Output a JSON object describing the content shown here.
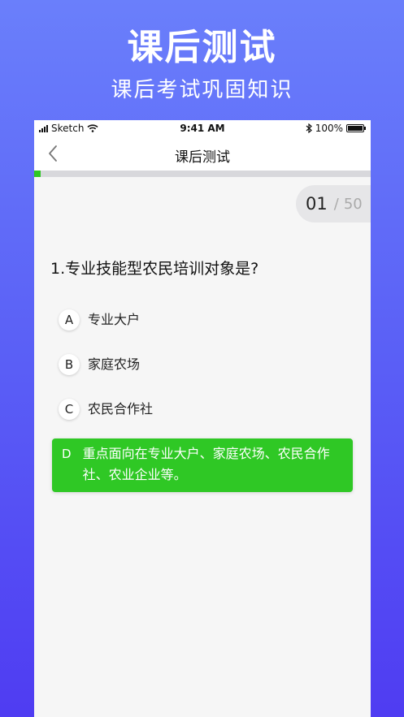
{
  "hero": {
    "title": "课后测试",
    "subtitle": "课后考试巩固知识"
  },
  "status_bar": {
    "carrier": "Sketch",
    "time": "9:41 AM",
    "battery": "100%"
  },
  "nav": {
    "title": "课后测试",
    "back_icon": "chevron-left-icon"
  },
  "progress": {
    "current": 1,
    "total": 50,
    "color": "#2fc825"
  },
  "counter": {
    "current": "01",
    "separator": "/",
    "total": "50"
  },
  "question": {
    "text": "1.专业技能型农民培训对象是?"
  },
  "options": [
    {
      "letter": "A",
      "text": "专业大户",
      "selected": false
    },
    {
      "letter": "B",
      "text": "家庭农场",
      "selected": false
    },
    {
      "letter": "C",
      "text": "农民合作社",
      "selected": false
    },
    {
      "letter": "D",
      "text": "重点面向在专业大户、家庭农场、农民合作社、农业企业等。",
      "selected": true
    }
  ],
  "colors": {
    "accent_green": "#2fc825",
    "background_top": "#6a7ffb",
    "background_bottom": "#4f3cf2"
  }
}
